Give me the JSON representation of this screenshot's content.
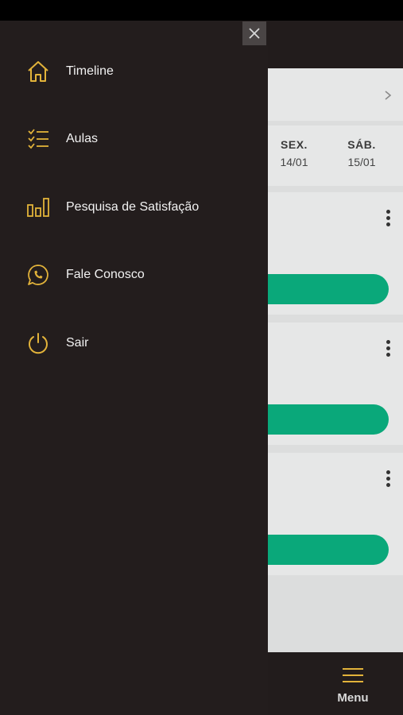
{
  "drawer": {
    "items": [
      {
        "label": "Timeline",
        "icon": "home-icon"
      },
      {
        "label": "Aulas",
        "icon": "checklist-icon"
      },
      {
        "label": "Pesquisa de Satisfação",
        "icon": "bar-chart-icon"
      },
      {
        "label": "Fale Conosco",
        "icon": "whatsapp-icon"
      },
      {
        "label": "Sair",
        "icon": "power-icon"
      }
    ],
    "close_icon": "close-icon"
  },
  "calendar": {
    "days": [
      {
        "name": "SEX.",
        "date": "14/01"
      },
      {
        "name": "SÁB.",
        "date": "15/01"
      }
    ]
  },
  "bottom_nav": {
    "menu_label": "Menu",
    "menu_icon": "hamburger-icon"
  },
  "colors": {
    "accent": "#e2b33a",
    "drawer_bg": "#231d1d",
    "button_green": "#0aa87a",
    "content_bg": "#e6e7e7"
  }
}
